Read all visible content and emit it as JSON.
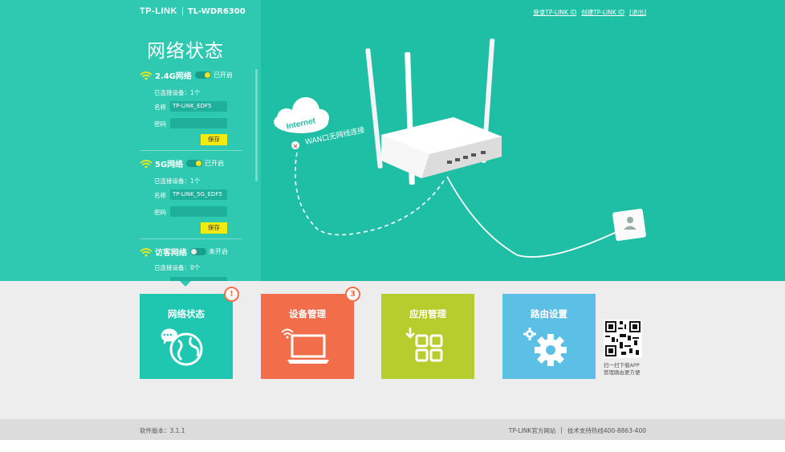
{
  "brand": {
    "logo": "TP-LINK",
    "model": "TL-WDR6300"
  },
  "page_title": "网络状态",
  "top_links": {
    "login": "登录TP-LINK ID",
    "create": "创建TP-LINK ID",
    "logout": "[退出]"
  },
  "networks": [
    {
      "name": "2.4G网络",
      "status": "已开启",
      "enabled": true,
      "connected": "已连接设备：1个",
      "ssid_label": "名称",
      "ssid": "TP-LINK_EDF5",
      "pwd_label": "密码",
      "pwd": "",
      "save": "保存"
    },
    {
      "name": "5G网络",
      "status": "已开启",
      "enabled": true,
      "connected": "已连接设备：1个",
      "ssid_label": "名称",
      "ssid": "TP-LINK_5G_EDF5",
      "pwd_label": "密码",
      "pwd": "",
      "save": "保存"
    },
    {
      "name": "访客网络",
      "status": "未开启",
      "enabled": false,
      "connected": "已连接设备：0个"
    }
  ],
  "illustration": {
    "cloud_label": "Internet",
    "wan_status": "WAN口无网线连接"
  },
  "tiles": [
    {
      "label": "网络状态",
      "color": "#1fc7b1",
      "icon": "globe-chat-icon",
      "badge": "!"
    },
    {
      "label": "设备管理",
      "color": "#f26e4a",
      "icon": "laptop-wifi-icon",
      "badge": "3"
    },
    {
      "label": "应用管理",
      "color": "#b5ce2e",
      "icon": "apps-grid-icon",
      "badge": ""
    },
    {
      "label": "路由设置",
      "color": "#5cc0e6",
      "icon": "gear-icon",
      "badge": ""
    }
  ],
  "qr": {
    "line1": "扫一扫下载APP",
    "line2": "管理路由更方便"
  },
  "footer": {
    "version": "软件版本：3.1.1",
    "site": "TP-LINK官方网站",
    "separator": "|",
    "hotline": "技术支持热线400-8863-400"
  },
  "colors": {
    "teal": "#1fbfa6",
    "panel": "#2fc9b1",
    "accent_yellow": "#f5ea10"
  }
}
